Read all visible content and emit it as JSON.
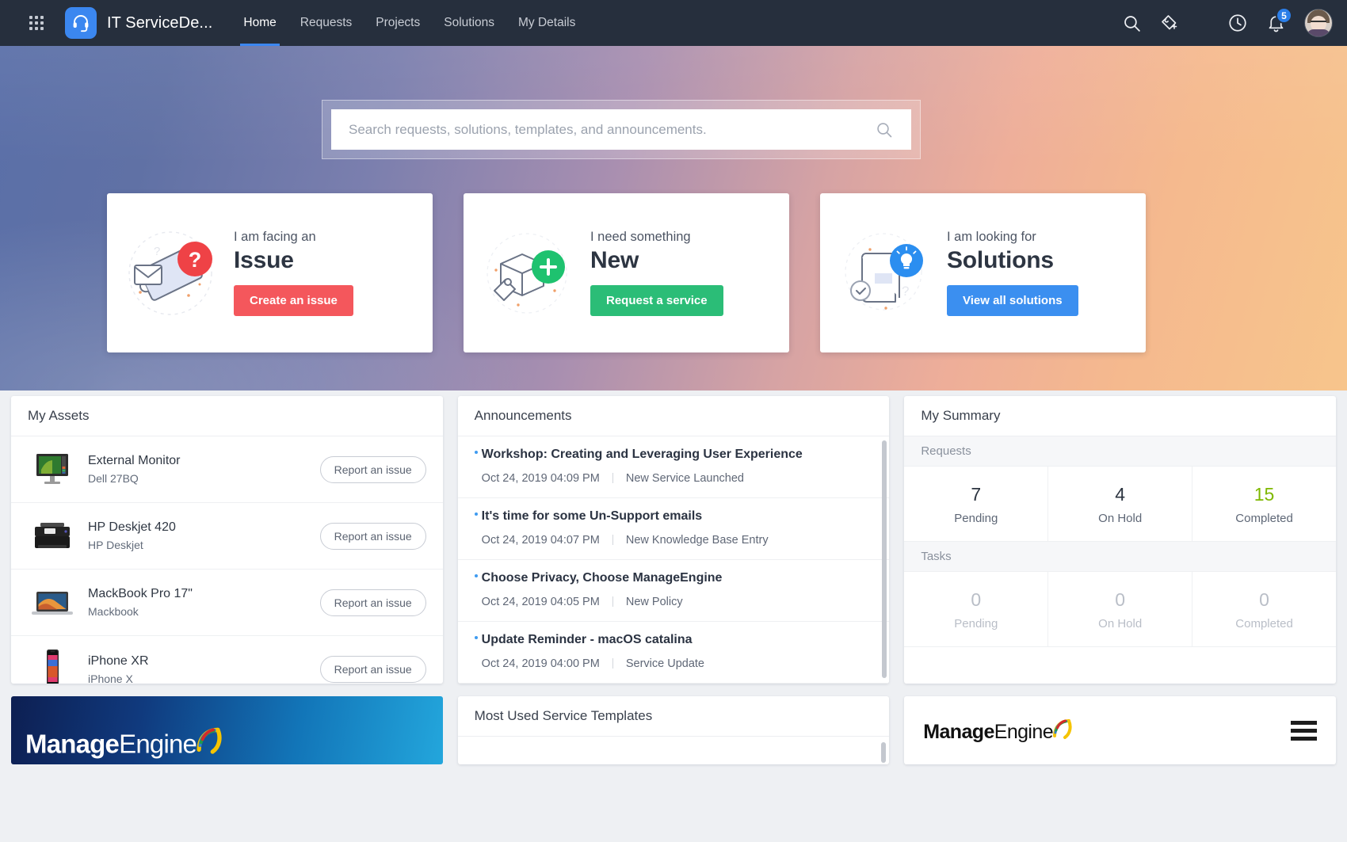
{
  "topnav": {
    "app_title": "IT ServiceDe...",
    "links": [
      {
        "label": "Home",
        "active": true
      },
      {
        "label": "Requests",
        "active": false
      },
      {
        "label": "Projects",
        "active": false
      },
      {
        "label": "Solutions",
        "active": false
      },
      {
        "label": "My Details",
        "active": false
      }
    ],
    "notification_count": "5",
    "accent_color": "#3b87f0"
  },
  "hero": {
    "search": {
      "placeholder": "Search requests, solutions, templates, and announcements.",
      "value": ""
    },
    "cards": [
      {
        "kicker": "I am facing an",
        "title": "Issue",
        "button": "Create an issue",
        "button_color": "#f4575c",
        "art": "envelope-ticket-question"
      },
      {
        "kicker": "I need something",
        "title": "New",
        "button": "Request a service",
        "button_color": "#2bbd77",
        "art": "box-tag-plus"
      },
      {
        "kicker": "I am looking for",
        "title": "Solutions",
        "button": "View all solutions",
        "button_color": "#3b8ff0",
        "art": "book-lightbulb"
      }
    ]
  },
  "assets": {
    "title": "My Assets",
    "action_label": "Report an issue",
    "items": [
      {
        "name": "External Monitor",
        "sub": "Dell 27BQ",
        "icon": "monitor-icon"
      },
      {
        "name": "HP Deskjet 420",
        "sub": "HP Deskjet",
        "icon": "printer-icon"
      },
      {
        "name": "MackBook Pro 17\"",
        "sub": "Mackbook",
        "icon": "laptop-icon"
      },
      {
        "name": "iPhone XR",
        "sub": "iPhone X",
        "icon": "phone-icon"
      }
    ]
  },
  "announcements": {
    "title": "Announcements",
    "items": [
      {
        "title": "Workshop: Creating and Leveraging User Experience",
        "date": "Oct 24, 2019 04:09 PM",
        "type": "New Service Launched"
      },
      {
        "title": "It's time for some Un-Support emails",
        "date": "Oct 24, 2019 04:07 PM",
        "type": "New Knowledge Base Entry"
      },
      {
        "title": "Choose Privacy, Choose ManageEngine",
        "date": "Oct 24, 2019 04:05 PM",
        "type": "New Policy"
      },
      {
        "title": "Update Reminder - macOS catalina",
        "date": "Oct 24, 2019 04:00 PM",
        "type": "Service Update"
      }
    ]
  },
  "summary": {
    "title": "My Summary",
    "groups": [
      {
        "label": "Requests",
        "muted": false,
        "stats": [
          {
            "value": "7",
            "caption": "Pending",
            "color": ""
          },
          {
            "value": "4",
            "caption": "On Hold",
            "color": ""
          },
          {
            "value": "15",
            "caption": "Completed",
            "color": "#7fb800"
          }
        ]
      },
      {
        "label": "Tasks",
        "muted": true,
        "stats": [
          {
            "value": "0",
            "caption": "Pending",
            "color": ""
          },
          {
            "value": "0",
            "caption": "On Hold",
            "color": ""
          },
          {
            "value": "0",
            "caption": "Completed",
            "color": ""
          }
        ]
      }
    ]
  },
  "bottom": {
    "banner_logo_bold": "Manage",
    "banner_logo_light": "Engine",
    "templates_title": "Most Used Service Templates",
    "footer_logo_bold": "Manage",
    "footer_logo_light": "Engine"
  }
}
